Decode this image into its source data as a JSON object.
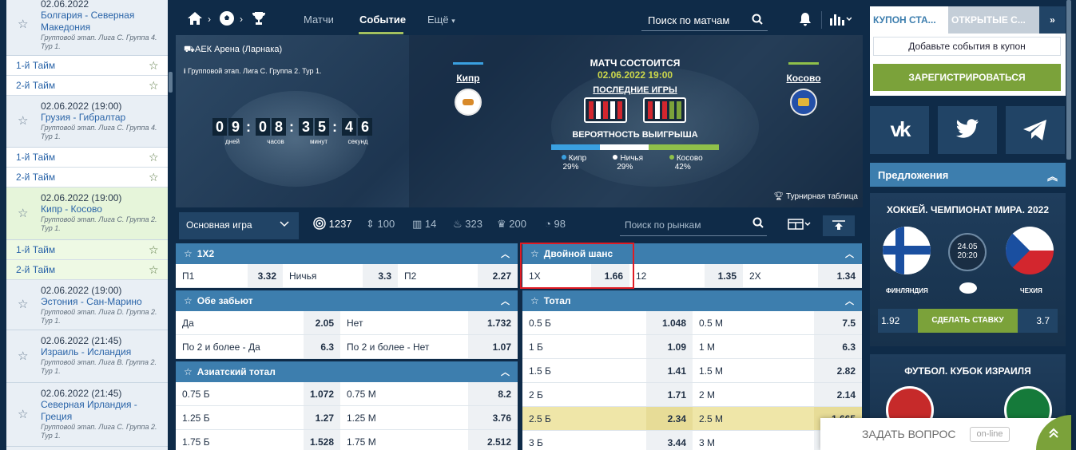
{
  "left_events": [
    {
      "date": "02.06.2022",
      "teams": "Болгария - Северная Македония",
      "group": "Групповой этап. Лига С. Группа 4. Тур 1."
    },
    {
      "date": "02.06.2022 (19:00)",
      "teams": "Грузия - Гибралтар",
      "group": "Групповой этап. Лига С. Группа 4. Тур 1."
    },
    {
      "date": "02.06.2022 (19:00)",
      "teams": "Кипр - Косово",
      "group": "Групповой этап. Лига С. Группа 2. Тур 1."
    },
    {
      "date": "02.06.2022 (19:00)",
      "teams": "Эстония - Сан-Марино",
      "group": "Групповой этап. Лига D. Группа 2. Тур 1."
    },
    {
      "date": "02.06.2022 (21:45)",
      "teams": "Израиль - Исландия",
      "group": "Групповой этап. Лига В. Группа 2. Тур 1."
    },
    {
      "date": "02.06.2022 (21:45)",
      "teams": "Северная Ирландия - Греция",
      "group": "Групповой этап. Лига С. Группа 2. Тур 1."
    }
  ],
  "halves": {
    "first": "1-й Тайм",
    "second": "2-й Тайм"
  },
  "nav": {
    "matches": "Матчи",
    "event": "Событие",
    "more": "Ещё",
    "search": "Поиск по матчам"
  },
  "banner": {
    "venue": "АЕК Арена (Ларнака)",
    "group": "Групповой этап. Лига С. Группа 2. Тур 1.",
    "countdown": {
      "days": "09",
      "hours": "08",
      "minutes": "35",
      "seconds": "46"
    },
    "countdown_labels": {
      "days": "дней",
      "hours": "часов",
      "minutes": "минут",
      "seconds": "секунд"
    },
    "team1": "Кипр",
    "team2": "Косово",
    "status": "МАТЧ СОСТОИТСЯ",
    "date": "02.06.2022 19:00",
    "last_games": "ПОСЛЕДНИЕ ИГРЫ",
    "probability": "ВЕРОЯТНОСТЬ ВЫИГРЫША",
    "prob_values": {
      "team1": 29,
      "draw": 29,
      "team2": 42
    },
    "prob_legend": {
      "team1": "Кипр 29%",
      "draw": "Ничья 29%",
      "team2": "Косово 42%"
    },
    "standings": "Турнирная таблица"
  },
  "toolbar": {
    "main_game": "Основная игра",
    "counts": {
      "all": "1237",
      "updown": "100",
      "stats": "14",
      "hot": "323",
      "cup": "200",
      "timer": "98"
    },
    "market_search": "Поиск по рынкам"
  },
  "markets": {
    "m1x2": {
      "title": "1X2",
      "rows": [
        [
          "П1",
          "3.32",
          "Ничья",
          "3.3",
          "П2",
          "2.27"
        ]
      ]
    },
    "double": {
      "title": "Двойной шанс",
      "rows": [
        [
          "1X",
          "1.66",
          "12",
          "1.35",
          "2X",
          "1.34"
        ]
      ]
    },
    "both": {
      "title": "Обе забьют",
      "rows": [
        [
          "Да",
          "2.05",
          "Нет",
          "1.732"
        ],
        [
          "По 2 и более - Да",
          "6.3",
          "По 2 и более - Нет",
          "1.07"
        ]
      ]
    },
    "total": {
      "title": "Тотал",
      "rows": [
        [
          "0.5 Б",
          "1.048",
          "0.5 М",
          "7.5"
        ],
        [
          "1 Б",
          "1.09",
          "1 М",
          "6.3"
        ],
        [
          "1.5 Б",
          "1.41",
          "1.5 М",
          "2.82"
        ],
        [
          "2 Б",
          "1.71",
          "2 М",
          "2.14"
        ],
        [
          "2.5 Б",
          "2.34",
          "2.5 М",
          "1.665"
        ],
        [
          "3 Б",
          "3.44",
          "3 М",
          ""
        ]
      ]
    },
    "asian": {
      "title": "Азиатский тотал",
      "rows": [
        [
          "0.75 Б",
          "1.072",
          "0.75 М",
          "8.2"
        ],
        [
          "1.25 Б",
          "1.27",
          "1.25 М",
          "3.76"
        ],
        [
          "1.75 Б",
          "1.528",
          "1.75 М",
          "2.512"
        ]
      ]
    }
  },
  "right": {
    "tab_coupon": "КУПОН СТА...",
    "tab_open": "ОТКРЫТЫЕ С...",
    "add_events": "Добавьте события в купон",
    "register": "ЗАРЕГИСТРИРОВАТЬСЯ",
    "offers": "Предложения",
    "promo1": {
      "title": "ХОККЕЙ. ЧЕМПИОНАТ МИРА. 2022",
      "date": "24.05",
      "time": "20:20",
      "team1": "ФИНЛЯНДИЯ",
      "team2": "ЧЕХИЯ",
      "odd1": "1.92",
      "bet": "СДЕЛАТЬ СТАВКУ",
      "odd2": "3.7"
    },
    "promo2": {
      "title": "ФУТБОЛ. КУБОК ИЗРАИЛЯ"
    }
  },
  "ask": {
    "label": "ЗАДАТЬ ВОПРОС",
    "status": "on-line"
  },
  "colors": {
    "accent_green": "#7ba23a",
    "header_blue": "#3d7eae",
    "navy": "#0f2b48",
    "highlight": "#e01b23"
  }
}
